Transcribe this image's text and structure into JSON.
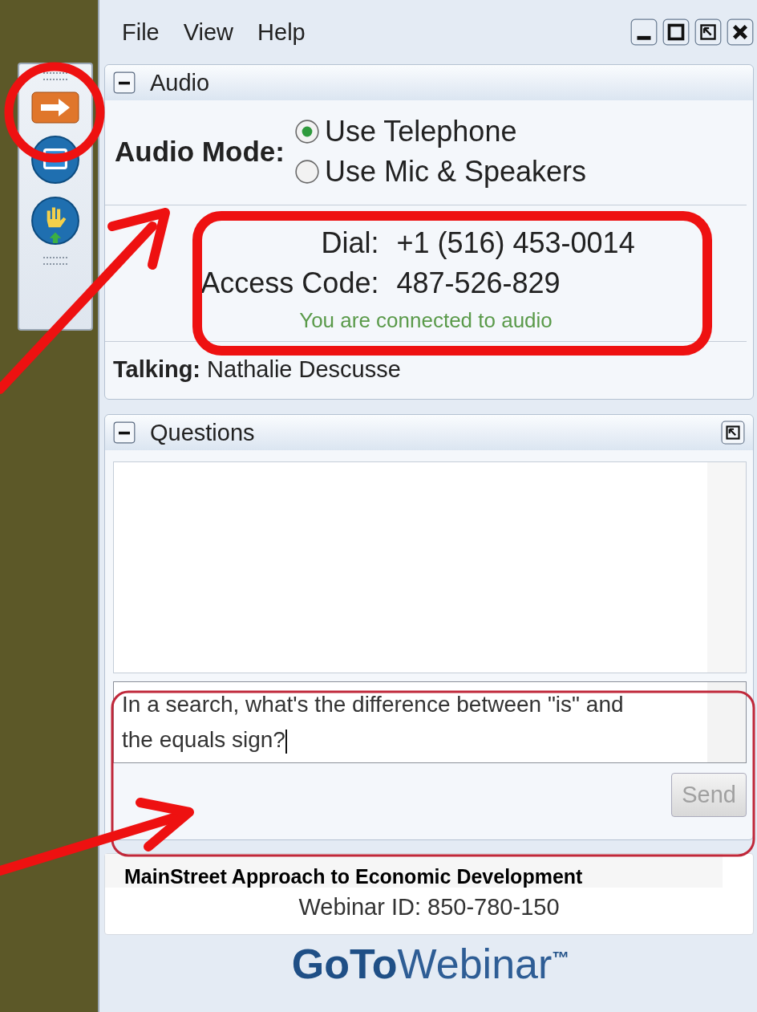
{
  "menu": [
    "File",
    "View",
    "Help"
  ],
  "audio": {
    "title": "Audio",
    "mode_label": "Audio Mode:",
    "options": [
      {
        "label": "Use Telephone",
        "selected": true
      },
      {
        "label": "Use Mic & Speakers",
        "selected": false
      }
    ],
    "dial_label": "Dial:",
    "dial": "+1 (516) 453-0014",
    "access_label": "Access Code:",
    "access_code": "487-526-829",
    "status": "You are connected to audio",
    "talking_label": "Talking:",
    "talking": "Nathalie Descusse"
  },
  "questions": {
    "title": "Questions",
    "input": "In a search, what's the difference between \"is\" and the equals sign?",
    "send": {
      "label": "Send",
      "disabled": true
    }
  },
  "footer": {
    "webinar_title": "MainStreet Approach to Economic Development",
    "webinar_id": "Webinar ID: 850-780-150",
    "logo_bold": "GoTo",
    "logo_light": "Webinar",
    "logo_tm": "™"
  }
}
